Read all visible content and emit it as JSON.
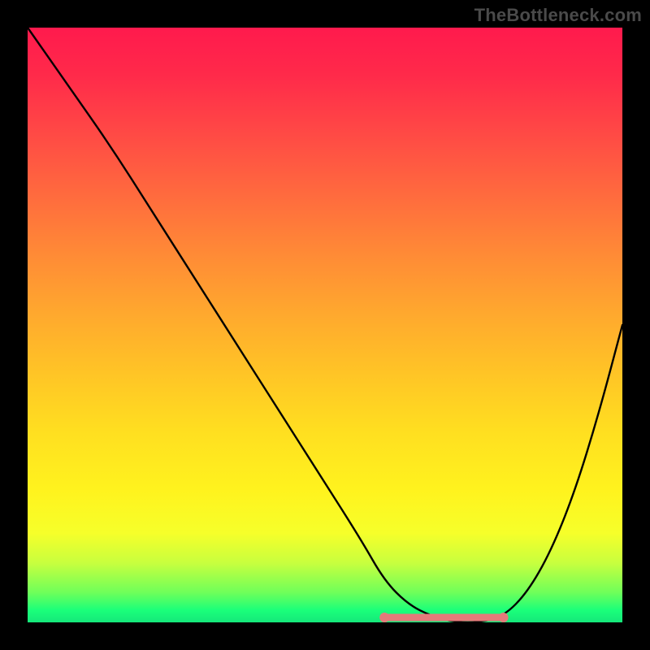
{
  "watermark": "TheBottleneck.com",
  "chart_data": {
    "type": "line",
    "title": "",
    "xlabel": "",
    "ylabel": "",
    "xlim": [
      0,
      100
    ],
    "ylim": [
      0,
      100
    ],
    "grid": false,
    "series": [
      {
        "name": "bottleneck-curve",
        "x": [
          0,
          7,
          14,
          21,
          28,
          35,
          42,
          49,
          56,
          60,
          64,
          68,
          72,
          76,
          80,
          84,
          88,
          92,
          96,
          100
        ],
        "values": [
          100,
          90,
          80,
          69,
          58,
          47,
          36,
          25,
          14,
          7,
          3,
          1,
          0,
          0,
          1,
          5,
          12,
          22,
          35,
          50
        ]
      }
    ],
    "markers": {
      "name": "optimal-range",
      "x_start": 60,
      "x_end": 80,
      "y": 0,
      "color": "#e47a7a"
    },
    "background_gradient": {
      "top": "#ff1a4d",
      "mid_upper": "#ff8a36",
      "mid_lower": "#fff31e",
      "bottom": "#15e77a"
    }
  }
}
